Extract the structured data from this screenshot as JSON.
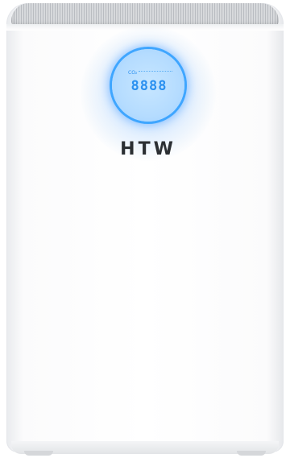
{
  "product": {
    "brand_logo": "HTW",
    "display_readout": "8888",
    "display_label": "CO₂",
    "accent_color": "#3fa6ff",
    "body_color": "#ffffff"
  }
}
